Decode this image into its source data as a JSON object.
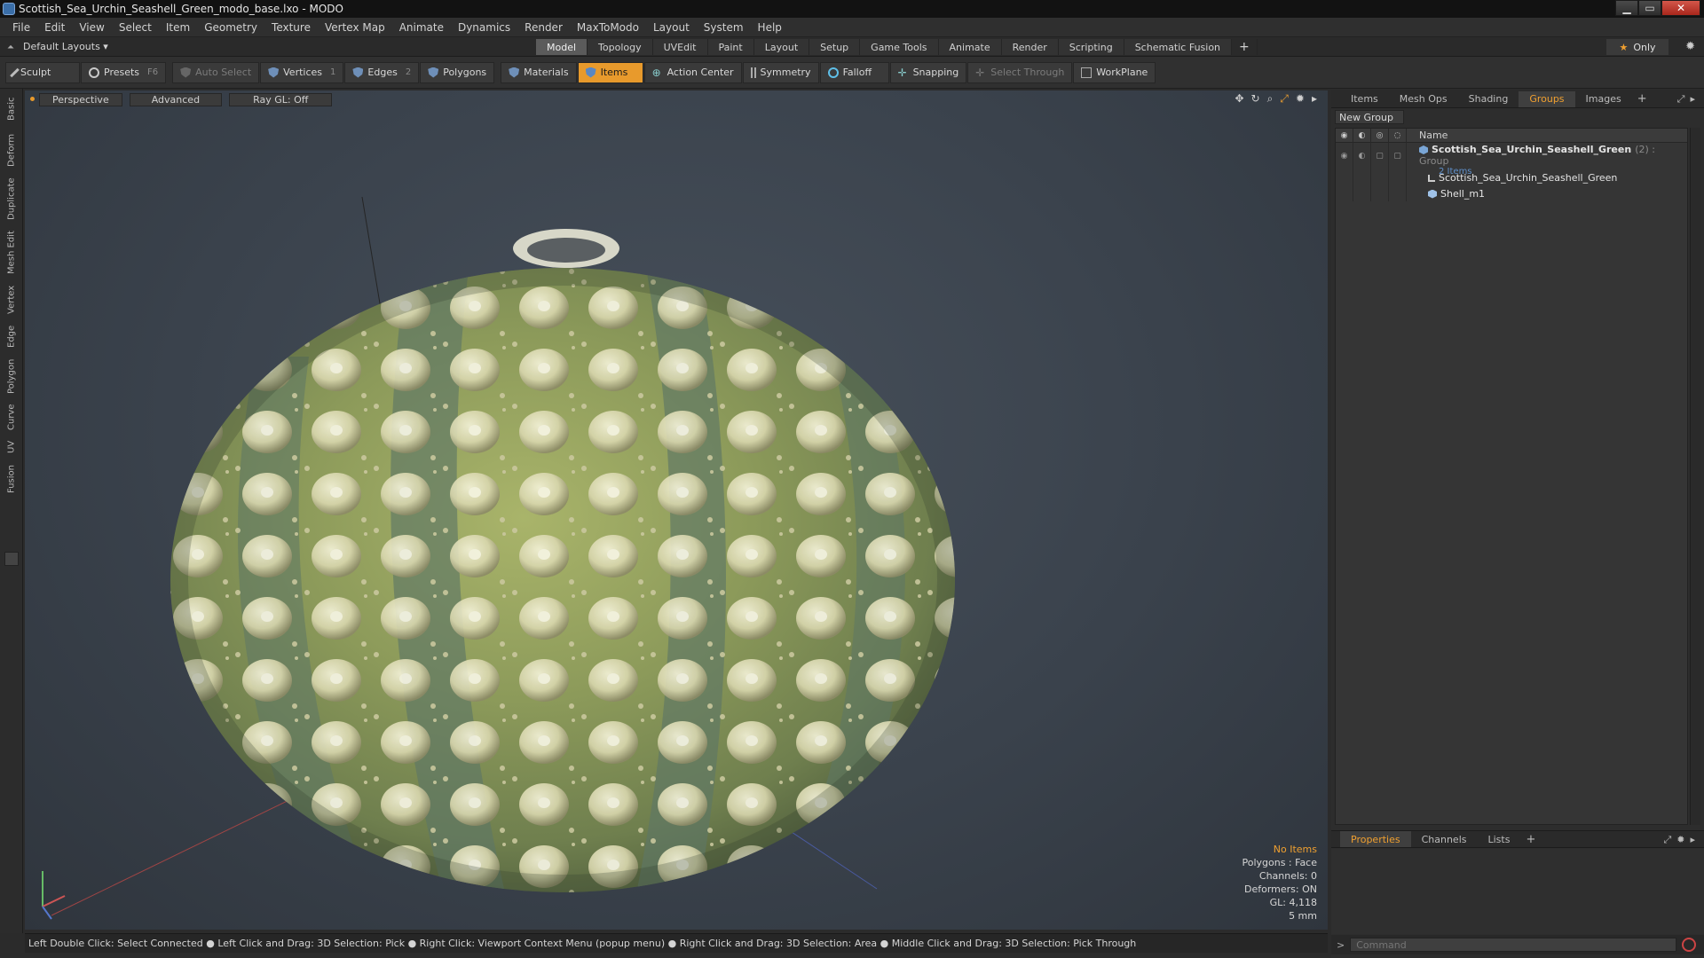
{
  "window": {
    "title": "Scottish_Sea_Urchin_Seashell_Green_modo_base.lxo - MODO",
    "min_icon": "minimize-icon",
    "max_icon": "maximize-icon",
    "close_label": "✕"
  },
  "menus": [
    "File",
    "Edit",
    "View",
    "Select",
    "Item",
    "Geometry",
    "Texture",
    "Vertex Map",
    "Animate",
    "Dynamics",
    "Render",
    "MaxToModo",
    "Layout",
    "System",
    "Help"
  ],
  "layout": {
    "preset": "Default Layouts ▾",
    "tabs": [
      "Model",
      "Topology",
      "UVEdit",
      "Paint",
      "Layout",
      "Setup",
      "Game Tools",
      "Animate",
      "Render",
      "Scripting",
      "Schematic Fusion"
    ],
    "active_tab": "Model",
    "plus": "+",
    "only_label": "Only"
  },
  "toolbar": {
    "sculpt": "Sculpt",
    "presets": "Presets",
    "presets_key": "F6",
    "auto_select": "Auto Select",
    "vertices": "Vertices",
    "vertices_key": "1",
    "edges": "Edges",
    "edges_key": "2",
    "polygons": "Polygons",
    "materials": "Materials",
    "items": "Items",
    "action_center": "Action Center",
    "symmetry": "Symmetry",
    "falloff": "Falloff",
    "snapping": "Snapping",
    "select_through": "Select Through",
    "workplane": "WorkPlane"
  },
  "left_tabs": [
    "Basic",
    "Deform",
    "Duplicate",
    "Mesh Edit",
    "Vertex",
    "Edge",
    "Polygon",
    "Curve",
    "UV",
    "Fusion"
  ],
  "viewport": {
    "view": "Perspective",
    "shading": "Advanced",
    "raygl": "Ray GL: Off",
    "info": {
      "selection": "No Items",
      "polygons": "Polygons : Face",
      "channels": "Channels: 0",
      "deformers": "Deformers: ON",
      "gl": "GL: 4,118",
      "scale": "5 mm"
    }
  },
  "status": "Left Double Click: Select Connected ● Left Click and Drag: 3D Selection: Pick ● Right Click: Viewport Context Menu (popup menu) ● Right Click and Drag: 3D Selection: Area ● Middle Click and Drag: 3D Selection: Pick Through",
  "right_panel": {
    "tabs": [
      "Items",
      "Mesh Ops",
      "Shading",
      "Groups",
      "Images"
    ],
    "active_tab": "Groups",
    "new_group": "New Group",
    "column_name": "Name",
    "tree": {
      "group_name": "Scottish_Sea_Urchin_Seashell_Green",
      "group_count": "(2) : Group",
      "group_sub": "2 Items",
      "child1": "Scottish_Sea_Urchin_Seashell_Green",
      "child2": "Shell_m1"
    },
    "bottom_tabs": [
      "Properties",
      "Channels",
      "Lists"
    ],
    "active_bottom": "Properties",
    "command_placeholder": "Command"
  },
  "colors": {
    "accent": "#e89a2c",
    "link": "#5e8fc9"
  }
}
